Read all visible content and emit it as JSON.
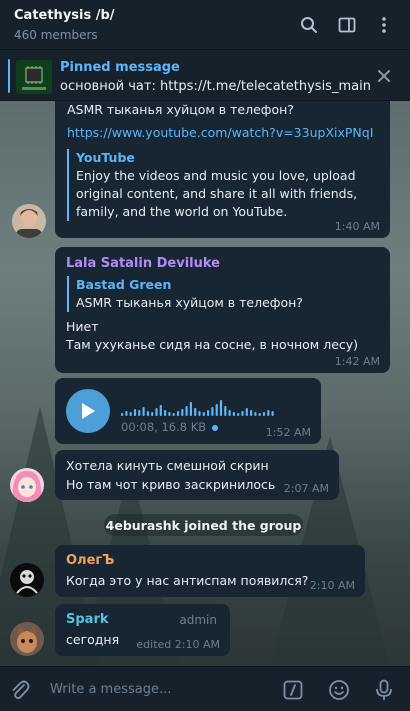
{
  "header": {
    "title": "Catethysis /b/",
    "members": "460 members"
  },
  "pinned": {
    "label": "Pinned message",
    "text": "основной чат: https://t.me/telecatethysis_main"
  },
  "messages": {
    "m1": {
      "text": "ASMR тыканья хуйцом в телефон?",
      "link": "https://www.youtube.com/watch?v=33upXixPNqI",
      "preview_site": "YouTube",
      "preview_desc": "Enjoy the videos and music you love, upload original content, and share it all with friends, family, and the world on YouTube.",
      "time": "1:40 AM"
    },
    "m2": {
      "sender": "Lala Satalin Deviluke",
      "reply_name": "Bastad Green",
      "reply_text": "ASMR тыканья хуйцом в телефон?",
      "line1": "Ниет",
      "line2": "Там ухуканье сидя на сосне, в ночном лесу)",
      "time": "1:42 AM"
    },
    "m3": {
      "meta": "00:08, 16.8 KB",
      "time": "1:52 AM"
    },
    "m4": {
      "line1": "Хотела кинуть смешной скрин",
      "line2": "Но там чот криво заскринилось",
      "time": "2:07 AM"
    },
    "service": "4eburashk joined the group",
    "m5": {
      "sender": "ОлегЪ",
      "text": "Когда это у нас антиспам появился?",
      "time": "2:10 AM"
    },
    "m6": {
      "sender": "Spark",
      "badge": "admin",
      "text": "сегодня",
      "time": "edited 2:10 AM"
    }
  },
  "composer": {
    "placeholder": "Write a message..."
  },
  "colors": {
    "accent": "#5eb5f7",
    "bubble": "#182533",
    "sender_lala": "#b38cf6",
    "sender_oleg": "#f2a35c",
    "sender_spark": "#58c3de"
  }
}
